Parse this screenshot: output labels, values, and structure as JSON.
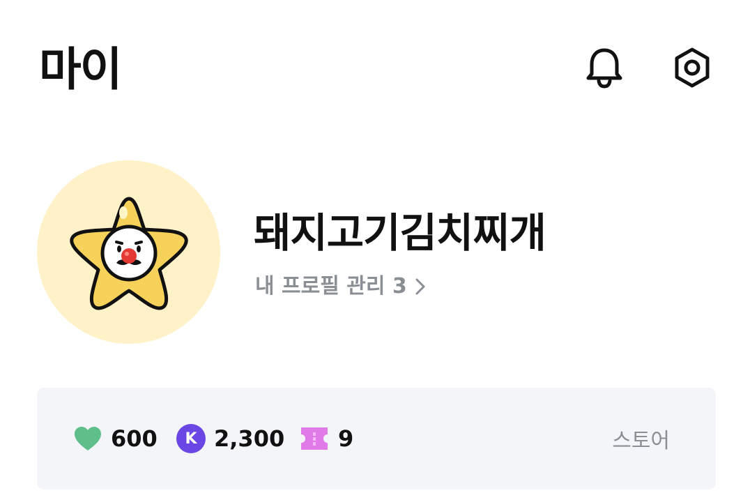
{
  "header": {
    "title": "마이",
    "icons": [
      "bell-icon",
      "settings-icon"
    ]
  },
  "profile": {
    "nickname": "돼지고기김치찌개",
    "manage_link_label": "내 프로필 관리 3",
    "avatar_icon": "star-mascot-icon",
    "avatar_bg_color": "#fff1c8"
  },
  "wallet": {
    "hearts": {
      "icon": "heart-icon",
      "value": "600",
      "color": "#5fbf8a"
    },
    "kcoins": {
      "icon": "k-coin-icon",
      "badge_text": "K",
      "value": "2,300",
      "color": "#6a46e5"
    },
    "tickets": {
      "icon": "ticket-icon",
      "value": "9",
      "color": "#e07ae6"
    },
    "store_label": "스토어"
  }
}
